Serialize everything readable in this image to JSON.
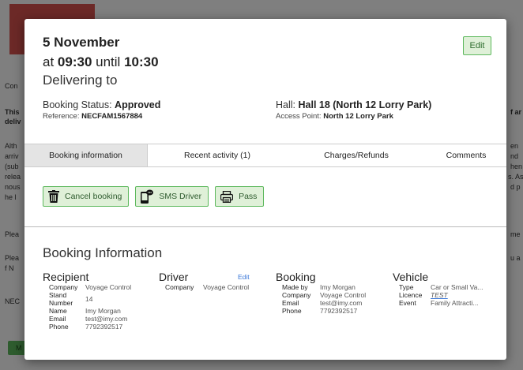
{
  "background": {
    "snippets": [
      "Con",
      "This",
      "deliv",
      "Alth",
      "arriv",
      "(sub",
      "relea",
      "nous",
      "he l",
      "Plea",
      "Plea",
      "f N",
      "NEC",
      "M",
      "f ar",
      "en",
      "nd",
      "hen",
      "s. As",
      "d p",
      "me",
      "u a"
    ]
  },
  "header": {
    "date": "5 November",
    "time_prefix": "at",
    "start_time": "09:30",
    "time_mid": "until",
    "end_time": "10:30",
    "delivering": "Delivering to",
    "edit_label": "Edit",
    "status_label": "Booking Status:",
    "status_value": "Approved",
    "reference_label": "Reference:",
    "reference_value": "NECFAM1567884",
    "hall_label": "Hall:",
    "hall_value": "Hall 18 (North 12 Lorry Park)",
    "access_label": "Access Point:",
    "access_value": "North 12 Lorry Park"
  },
  "tabs": [
    {
      "label": "Booking information",
      "active": true
    },
    {
      "label": "Recent activity (1)",
      "active": false
    },
    {
      "label": "Charges/Refunds",
      "active": false
    },
    {
      "label": "Comments",
      "active": false
    }
  ],
  "actions": {
    "cancel": "Cancel booking",
    "sms": "SMS Driver",
    "pass": "Pass"
  },
  "info": {
    "title": "Booking Information",
    "recipient": {
      "title": "Recipient",
      "rows": [
        {
          "k": "Company",
          "v": "Voyage Control"
        },
        {
          "k": "Stand Number",
          "v": "14"
        },
        {
          "k": "Name",
          "v": "Imy Morgan"
        },
        {
          "k": "Email",
          "v": "test@imy.com"
        },
        {
          "k": "Phone",
          "v": "7792392517"
        }
      ]
    },
    "driver": {
      "title": "Driver",
      "edit": "Edit",
      "rows": [
        {
          "k": "Company",
          "v": "Voyage Control"
        }
      ]
    },
    "booking": {
      "title": "Booking",
      "rows": [
        {
          "k": "Made by",
          "v": "Imy Morgan"
        },
        {
          "k": "Company",
          "v": "Voyage Control"
        },
        {
          "k": "Email",
          "v": "test@imy.com"
        },
        {
          "k": "Phone",
          "v": "7792392517"
        }
      ]
    },
    "vehicle": {
      "title": "Vehicle",
      "rows": [
        {
          "k": "Type",
          "v": "Car or Small Va..."
        },
        {
          "k": "Licence",
          "v": "TEST"
        },
        {
          "k": "Event",
          "v": "Family Attracti..."
        }
      ]
    }
  },
  "colors": {
    "accent_green": "#5cb85c",
    "button_bg": "#dff0d8",
    "link_blue": "#3c78d8"
  }
}
